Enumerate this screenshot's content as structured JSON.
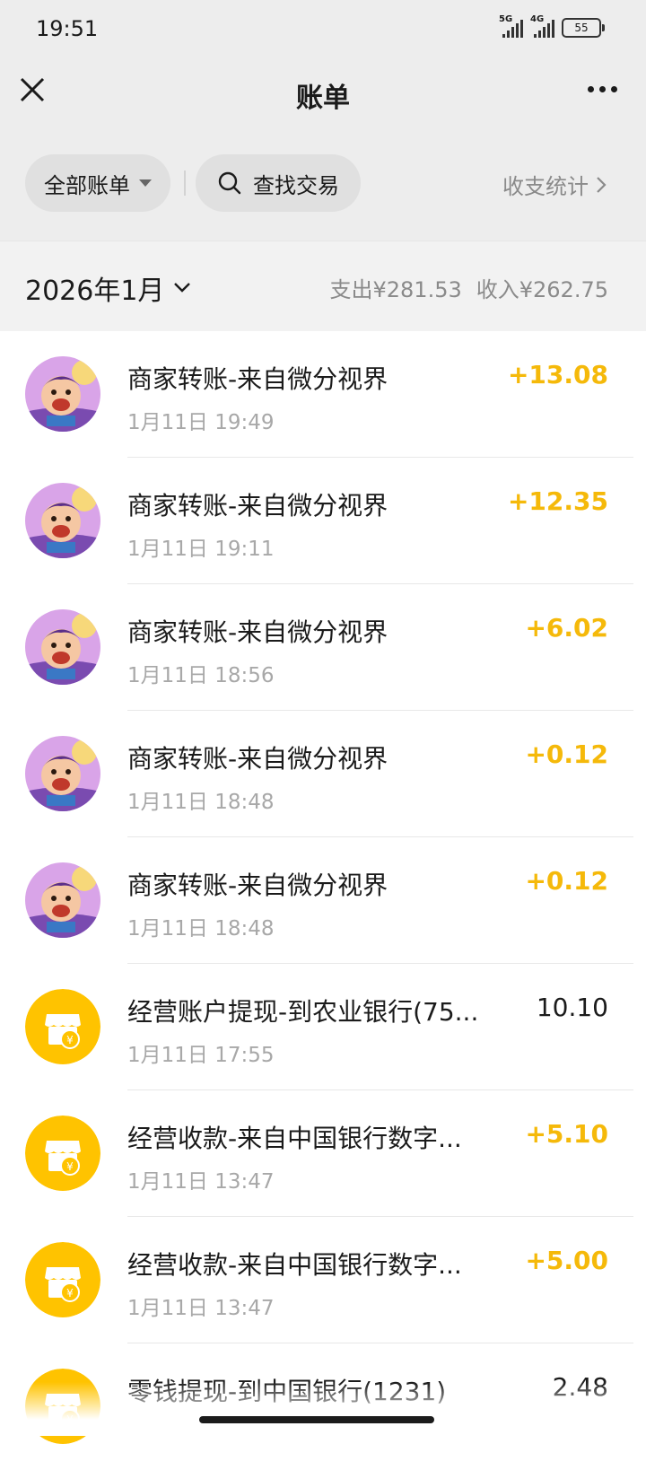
{
  "status_bar": {
    "time": "19:51",
    "network1": "5G",
    "network2": "4G",
    "battery": "55"
  },
  "nav": {
    "title": "账单"
  },
  "filters": {
    "all_label": "全部账单",
    "search_label": "查找交易",
    "stats_label": "收支统计"
  },
  "month": {
    "label": "2026年1月",
    "expense": "支出¥281.53",
    "income": "收入¥262.75"
  },
  "colors": {
    "income": "#f5b90a",
    "shop_icon": "#ffc300"
  },
  "transactions": [
    {
      "title": "商家转账-来自微分视界",
      "time": "1月11日 19:49",
      "amount": "+13.08",
      "icon": "cartoon-avatar-icon"
    },
    {
      "title": "商家转账-来自微分视界",
      "time": "1月11日 19:11",
      "amount": "+12.35",
      "icon": "cartoon-avatar-icon"
    },
    {
      "title": "商家转账-来自微分视界",
      "time": "1月11日 18:56",
      "amount": "+6.02",
      "icon": "cartoon-avatar-icon"
    },
    {
      "title": "商家转账-来自微分视界",
      "time": "1月11日 18:48",
      "amount": "+0.12",
      "icon": "cartoon-avatar-icon"
    },
    {
      "title": "商家转账-来自微分视界",
      "time": "1月11日 18:48",
      "amount": "+0.12",
      "icon": "cartoon-avatar-icon"
    },
    {
      "title": "经营账户提现-到农业银行(75...",
      "time": "1月11日 17:55",
      "amount": "10.10",
      "icon": "shop-yuan-icon"
    },
    {
      "title": "经营收款-来自中国银行数字...",
      "time": "1月11日 13:47",
      "amount": "+5.10",
      "icon": "shop-yuan-icon"
    },
    {
      "title": "经营收款-来自中国银行数字...",
      "time": "1月11日 13:47",
      "amount": "+5.00",
      "icon": "shop-yuan-icon"
    },
    {
      "title": "零钱提现-到中国银行(1231)",
      "time": "",
      "amount": "2.48",
      "icon": "shop-yuan-icon"
    }
  ]
}
